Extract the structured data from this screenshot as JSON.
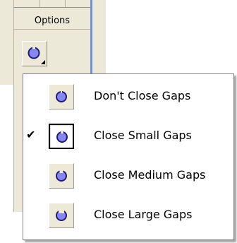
{
  "toolbar": {
    "section_label": "Options",
    "options_button_icon": "gap-circle-icon"
  },
  "menu": {
    "items": [
      {
        "label": "Don't Close Gaps",
        "icon": "gap-circle-icon",
        "checked": false
      },
      {
        "label": "Close Small Gaps",
        "icon": "gap-circle-small-icon",
        "checked": true,
        "check_mark": "✔"
      },
      {
        "label": "Close Medium Gaps",
        "icon": "gap-circle-medium-icon",
        "checked": false
      },
      {
        "label": "Close Large Gaps",
        "icon": "gap-circle-large-icon",
        "checked": false
      }
    ]
  },
  "colors": {
    "icon_fill": "#8585f4",
    "icon_stroke": "#1e1e6e",
    "toolbar_bg": "#ece9d8",
    "edge_blue": "#6e93d6"
  }
}
